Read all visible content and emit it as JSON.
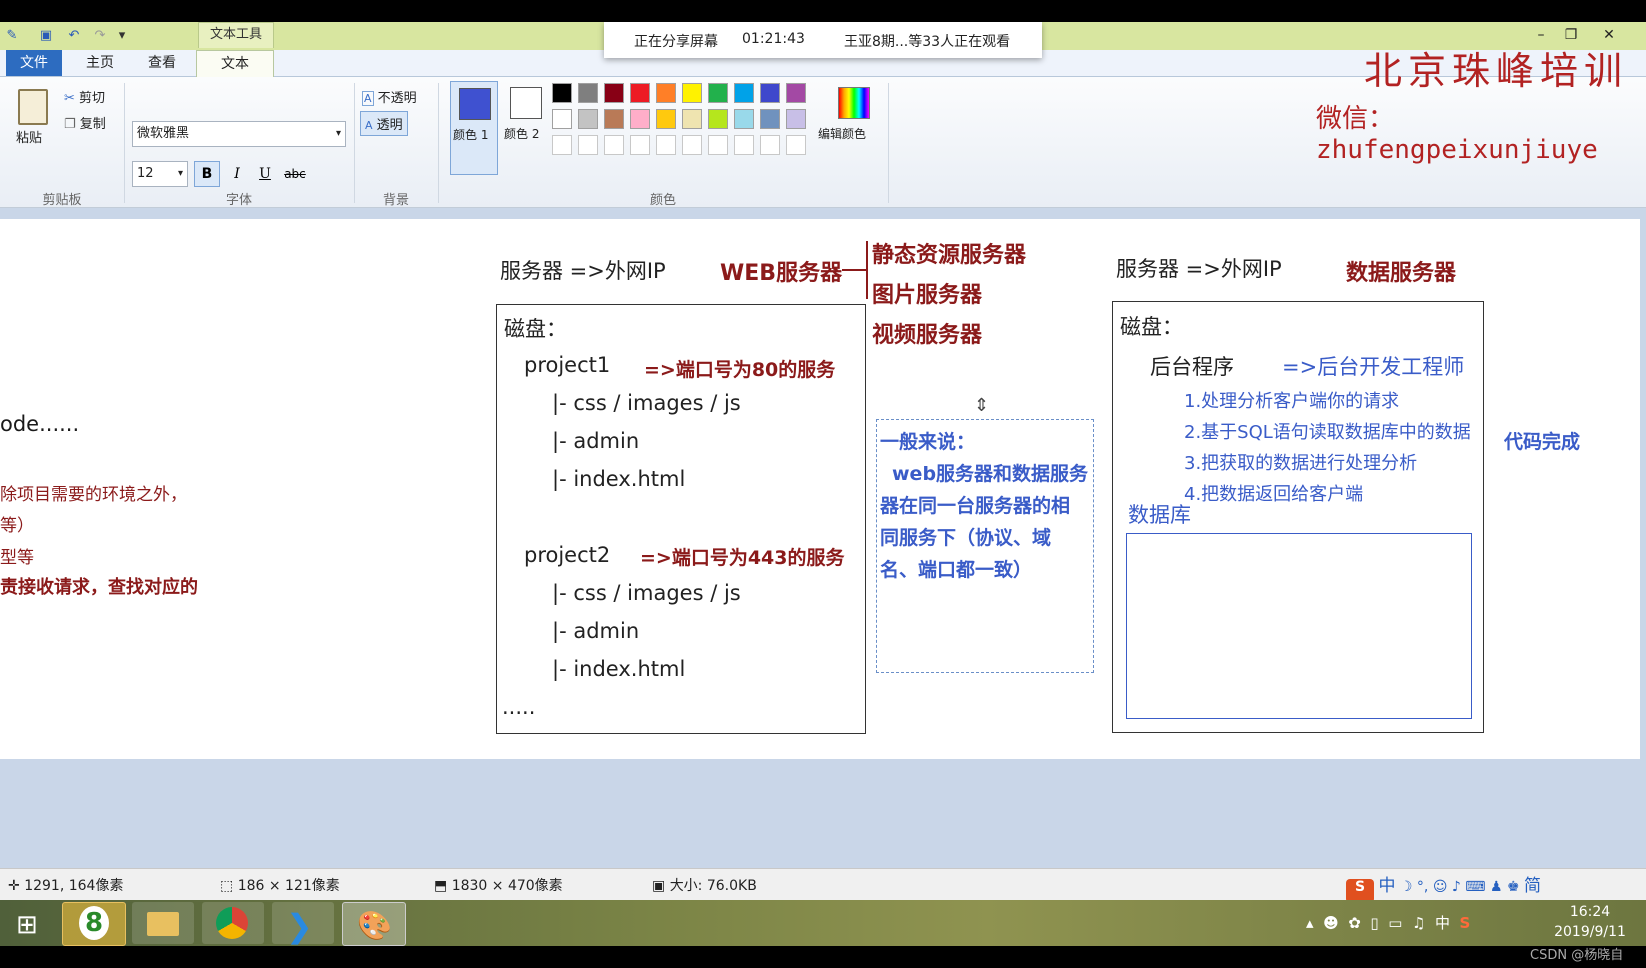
{
  "share": {
    "status": "正在分享屏幕",
    "time": "01:21:43",
    "viewers": "王亚8期...等33人正在观看"
  },
  "titlebar": {
    "context_tab": "文本工具"
  },
  "tabs": [
    "文件",
    "主页",
    "查看",
    "文本"
  ],
  "ribbon": {
    "clipboard": {
      "paste": "粘贴",
      "cut": "剪切",
      "copy": "复制",
      "label": "剪贴板"
    },
    "font": {
      "family": "微软雅黑",
      "size": "12",
      "bold": "B",
      "italic": "I",
      "underline": "U",
      "strike": "abc",
      "label": "字体"
    },
    "background": {
      "opaque": "不透明",
      "transparent": "透明",
      "label": "背景"
    },
    "colors": {
      "color1": "颜色 1",
      "color2": "颜色 2",
      "edit": "编辑颜色",
      "label": "颜色",
      "active1": "#3f51d0",
      "active2": "#ffffff",
      "row1": [
        "#000000",
        "#7f7f7f",
        "#880015",
        "#ed1c24",
        "#ff7f27",
        "#fff200",
        "#22b14c",
        "#00a2e8",
        "#3f48cc",
        "#a349a4"
      ],
      "row2": [
        "#ffffff",
        "#c3c3c3",
        "#b97a57",
        "#ffaec9",
        "#ffc90e",
        "#efe4b0",
        "#b5e61d",
        "#99d9ea",
        "#7092be",
        "#c8bfe7"
      ]
    }
  },
  "logo": {
    "line1": "北京珠峰培训",
    "line2": "微信：zhufengpeixunjiuye"
  },
  "canvas": {
    "left_fragments": [
      "ode......",
      "除项目需要的环境之外，",
      "等）",
      "型等",
      "责接收请求，查找对应的"
    ],
    "web": {
      "header": "服务器 =>外网IP",
      "title": "WEB服务器",
      "disk": "磁盘：",
      "project1": "project1",
      "p1_note": "=>端口号为80的服务",
      "p1_files": [
        "|- css / images / js",
        "|- admin",
        "|- index.html"
      ],
      "project2": "project2",
      "p2_note": "=>端口号为443的服务",
      "p2_files": [
        "|- css / images / js",
        "|- admin",
        "|- index.html"
      ],
      "more": "....."
    },
    "branches": [
      "静态资源服务器",
      "图片服务器",
      "视频服务器"
    ],
    "note": [
      "一般来说：",
      "web服务器和数据服务",
      "器在同一台服务器的相",
      "同服务下（协议、域",
      "名、端口都一致）"
    ],
    "data": {
      "header": "服务器 =>外网IP",
      "title": "数据服务器",
      "disk": "磁盘：",
      "backend": "后台程序",
      "backend_note": "=>后台开发工程师",
      "steps": [
        "1.处理分析客户端你的请求",
        "2.基于SQL语句读取数据库中的数据",
        "3.把获取的数据进行处理分析",
        "4.把数据返回给客户端"
      ],
      "db": "数据库",
      "code_done": "代码完成"
    }
  },
  "status": {
    "cursor": "1291, 164像素",
    "selection": "186 × 121像素",
    "image": "1830 × 470像素",
    "size": "大小: 76.0KB"
  },
  "ime": {
    "lang": "中",
    "mode": "简"
  },
  "tray": {
    "lang": "中",
    "time": "16:24",
    "date": "2019/9/11"
  },
  "watermark": "CSDN @杨晓自"
}
